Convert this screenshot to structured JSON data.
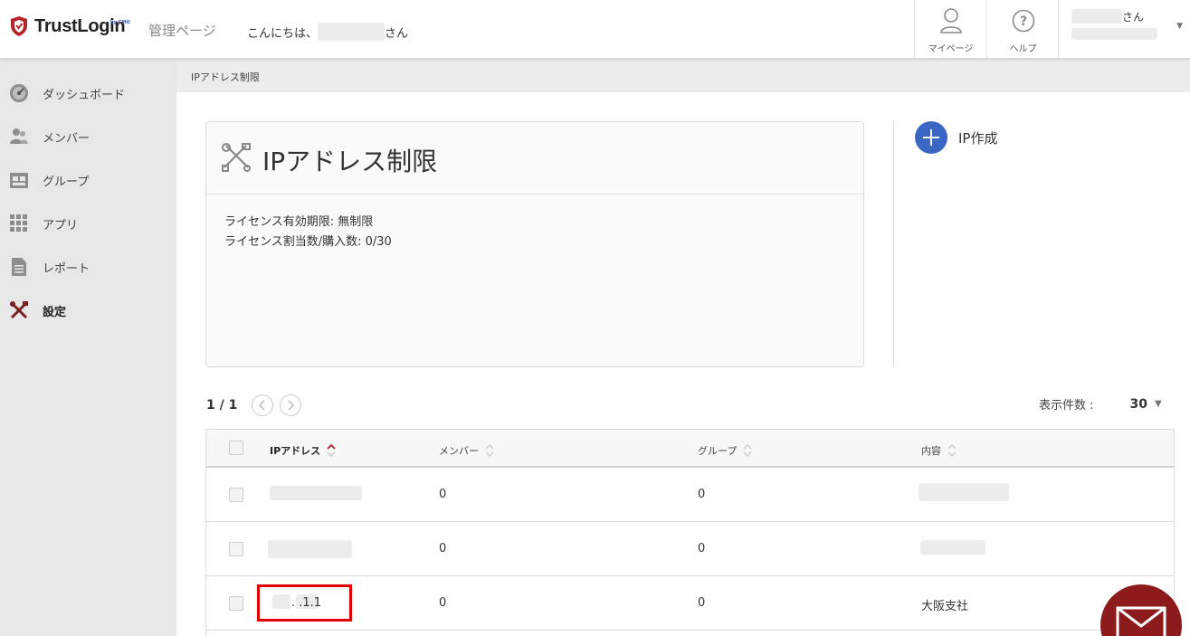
{
  "header": {
    "brand": "TrustLogin",
    "brand_sub": "by GMO",
    "admin_label": "管理ページ",
    "greeting_prefix": "こんにちは、",
    "greeting_suffix": "さん",
    "mypage_label": "マイページ",
    "help_label": "ヘルプ",
    "user_suffix": "さん"
  },
  "sidebar": {
    "items": [
      {
        "label": "ダッシュボード",
        "icon": "dashboard-icon"
      },
      {
        "label": "メンバー",
        "icon": "members-icon"
      },
      {
        "label": "グループ",
        "icon": "group-icon"
      },
      {
        "label": "アプリ",
        "icon": "apps-grid-icon"
      },
      {
        "label": "レポート",
        "icon": "report-icon"
      },
      {
        "label": "設定",
        "icon": "settings-tools-icon",
        "active": true
      }
    ]
  },
  "breadcrumb": "IPアドレス制限",
  "card": {
    "title": "IPアドレス制限",
    "license_period": "ライセンス有効期限: 無制限",
    "license_count": "ライセンス割当数/購入数: 0/30"
  },
  "create_button": "IP作成",
  "pager": {
    "text": "1 / 1",
    "per_page_label": "表示件数 :",
    "per_page_value": "30"
  },
  "table": {
    "headers": [
      "IPアドレス",
      "メンバー",
      "グループ",
      "内容"
    ],
    "rows": [
      {
        "ip": "",
        "members": "0",
        "groups": "0",
        "content": ""
      },
      {
        "ip": "",
        "members": "0",
        "groups": "0",
        "content": ""
      },
      {
        "ip": ". .1.1",
        "members": "0",
        "groups": "0",
        "content": "大阪支社"
      }
    ]
  },
  "colors": {
    "accent_blue": "#3a67c3",
    "brand_red": "#b3262a",
    "highlight_red": "#e00000",
    "fab_red": "#8e1b1b"
  }
}
